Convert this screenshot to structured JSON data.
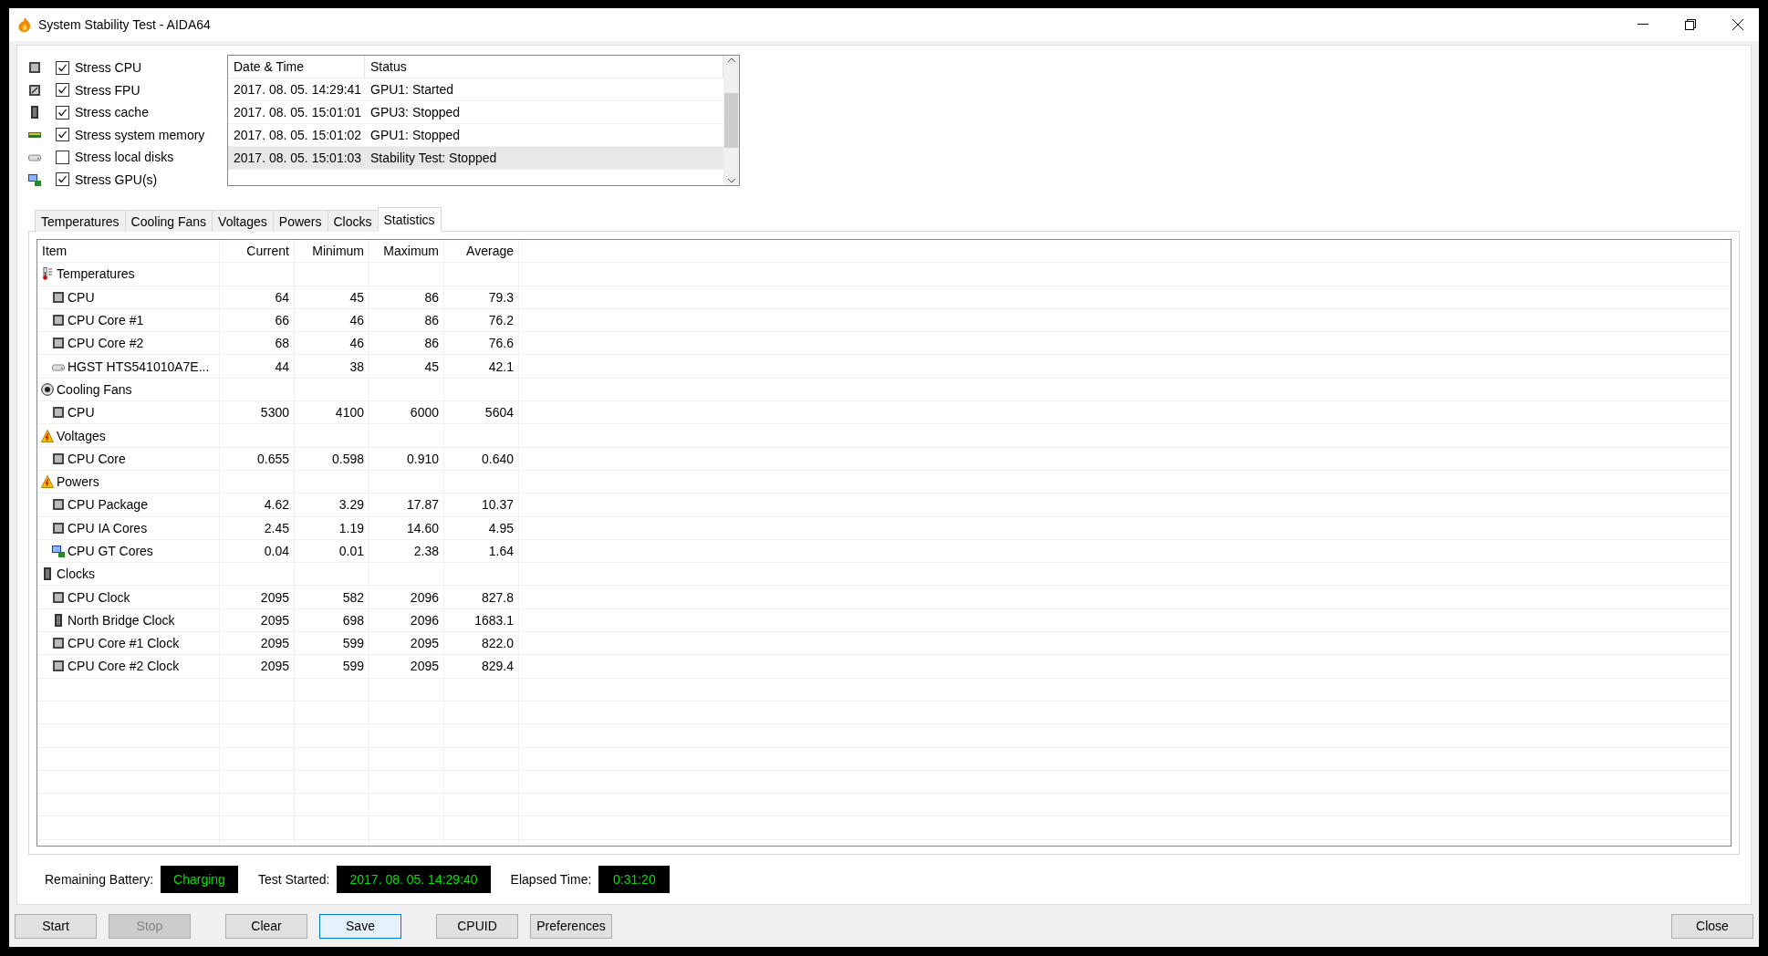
{
  "window": {
    "title": "System Stability Test - AIDA64"
  },
  "stress_options": [
    {
      "label": "Stress CPU",
      "checked": true,
      "kind": "cpu"
    },
    {
      "label": "Stress FPU",
      "checked": true,
      "kind": "fpu"
    },
    {
      "label": "Stress cache",
      "checked": true,
      "kind": "cache"
    },
    {
      "label": "Stress system memory",
      "checked": true,
      "kind": "memory"
    },
    {
      "label": "Stress local disks",
      "checked": false,
      "kind": "disk"
    },
    {
      "label": "Stress GPU(s)",
      "checked": true,
      "kind": "gpu"
    }
  ],
  "log": {
    "columns": [
      "Date & Time",
      "Status"
    ],
    "rows": [
      {
        "time": "2017. 08. 05. 14:29:41",
        "status": "GPU1: Started",
        "selected": false
      },
      {
        "time": "2017. 08. 05. 15:01:01",
        "status": "GPU3: Stopped",
        "selected": false
      },
      {
        "time": "2017. 08. 05. 15:01:02",
        "status": "GPU1: Stopped",
        "selected": false
      },
      {
        "time": "2017. 08. 05. 15:01:03",
        "status": "Stability Test: Stopped",
        "selected": true
      }
    ]
  },
  "tabs": [
    {
      "label": "Temperatures",
      "selected": false
    },
    {
      "label": "Cooling Fans",
      "selected": false
    },
    {
      "label": "Voltages",
      "selected": false
    },
    {
      "label": "Powers",
      "selected": false
    },
    {
      "label": "Clocks",
      "selected": false
    },
    {
      "label": "Statistics",
      "selected": true
    }
  ],
  "statistics": {
    "columns": [
      "Item",
      "Current",
      "Minimum",
      "Maximum",
      "Average"
    ],
    "groups": [
      {
        "label": "Temperatures",
        "kind": "thermometer",
        "children": [
          {
            "label": "CPU",
            "kind": "cpu",
            "values": [
              "64",
              "45",
              "86",
              "79.3"
            ]
          },
          {
            "label": "CPU Core #1",
            "kind": "cpu",
            "values": [
              "66",
              "46",
              "86",
              "76.2"
            ]
          },
          {
            "label": "CPU Core #2",
            "kind": "cpu",
            "values": [
              "68",
              "46",
              "86",
              "76.6"
            ]
          },
          {
            "label": "HGST HTS541010A7E...",
            "kind": "disk",
            "values": [
              "44",
              "38",
              "45",
              "42.1"
            ]
          }
        ]
      },
      {
        "label": "Cooling Fans",
        "kind": "fan",
        "children": [
          {
            "label": "CPU",
            "kind": "cpu",
            "values": [
              "5300",
              "4100",
              "6000",
              "5604"
            ]
          }
        ]
      },
      {
        "label": "Voltages",
        "kind": "warning",
        "children": [
          {
            "label": "CPU Core",
            "kind": "cpu",
            "values": [
              "0.655",
              "0.598",
              "0.910",
              "0.640"
            ]
          }
        ]
      },
      {
        "label": "Powers",
        "kind": "warning",
        "children": [
          {
            "label": "CPU Package",
            "kind": "cpu",
            "values": [
              "4.62",
              "3.29",
              "17.87",
              "10.37"
            ]
          },
          {
            "label": "CPU IA Cores",
            "kind": "cpu",
            "values": [
              "2.45",
              "1.19",
              "14.60",
              "4.95"
            ]
          },
          {
            "label": "CPU GT Cores",
            "kind": "gpu",
            "values": [
              "0.04",
              "0.01",
              "2.38",
              "1.64"
            ]
          }
        ]
      },
      {
        "label": "Clocks",
        "kind": "cache",
        "children": [
          {
            "label": "CPU Clock",
            "kind": "cpu",
            "values": [
              "2095",
              "582",
              "2096",
              "827.8"
            ]
          },
          {
            "label": "North Bridge Clock",
            "kind": "cache",
            "values": [
              "2095",
              "698",
              "2096",
              "1683.1"
            ]
          },
          {
            "label": "CPU Core #1 Clock",
            "kind": "cpu",
            "values": [
              "2095",
              "599",
              "2095",
              "822.0"
            ]
          },
          {
            "label": "CPU Core #2 Clock",
            "kind": "cpu",
            "values": [
              "2095",
              "599",
              "2095",
              "829.4"
            ]
          }
        ]
      }
    ]
  },
  "status_fields": [
    {
      "label": "Remaining Battery:",
      "value": "Charging"
    },
    {
      "label": "Test Started:",
      "value": "2017. 08. 05. 14:29:40"
    },
    {
      "label": "Elapsed Time:",
      "value": "0:31:20"
    }
  ],
  "buttons": [
    {
      "label": "Start",
      "disabled": false,
      "highlighted": false
    },
    {
      "label": "Stop",
      "disabled": true,
      "highlighted": false
    },
    {
      "label": "Clear",
      "disabled": false,
      "highlighted": false
    },
    {
      "label": "Save",
      "disabled": false,
      "highlighted": true
    },
    {
      "label": "CPUID",
      "disabled": false,
      "highlighted": false
    },
    {
      "label": "Preferences",
      "disabled": false,
      "highlighted": false
    }
  ],
  "close_button": {
    "label": "Close",
    "disabled": false,
    "highlighted": false
  }
}
